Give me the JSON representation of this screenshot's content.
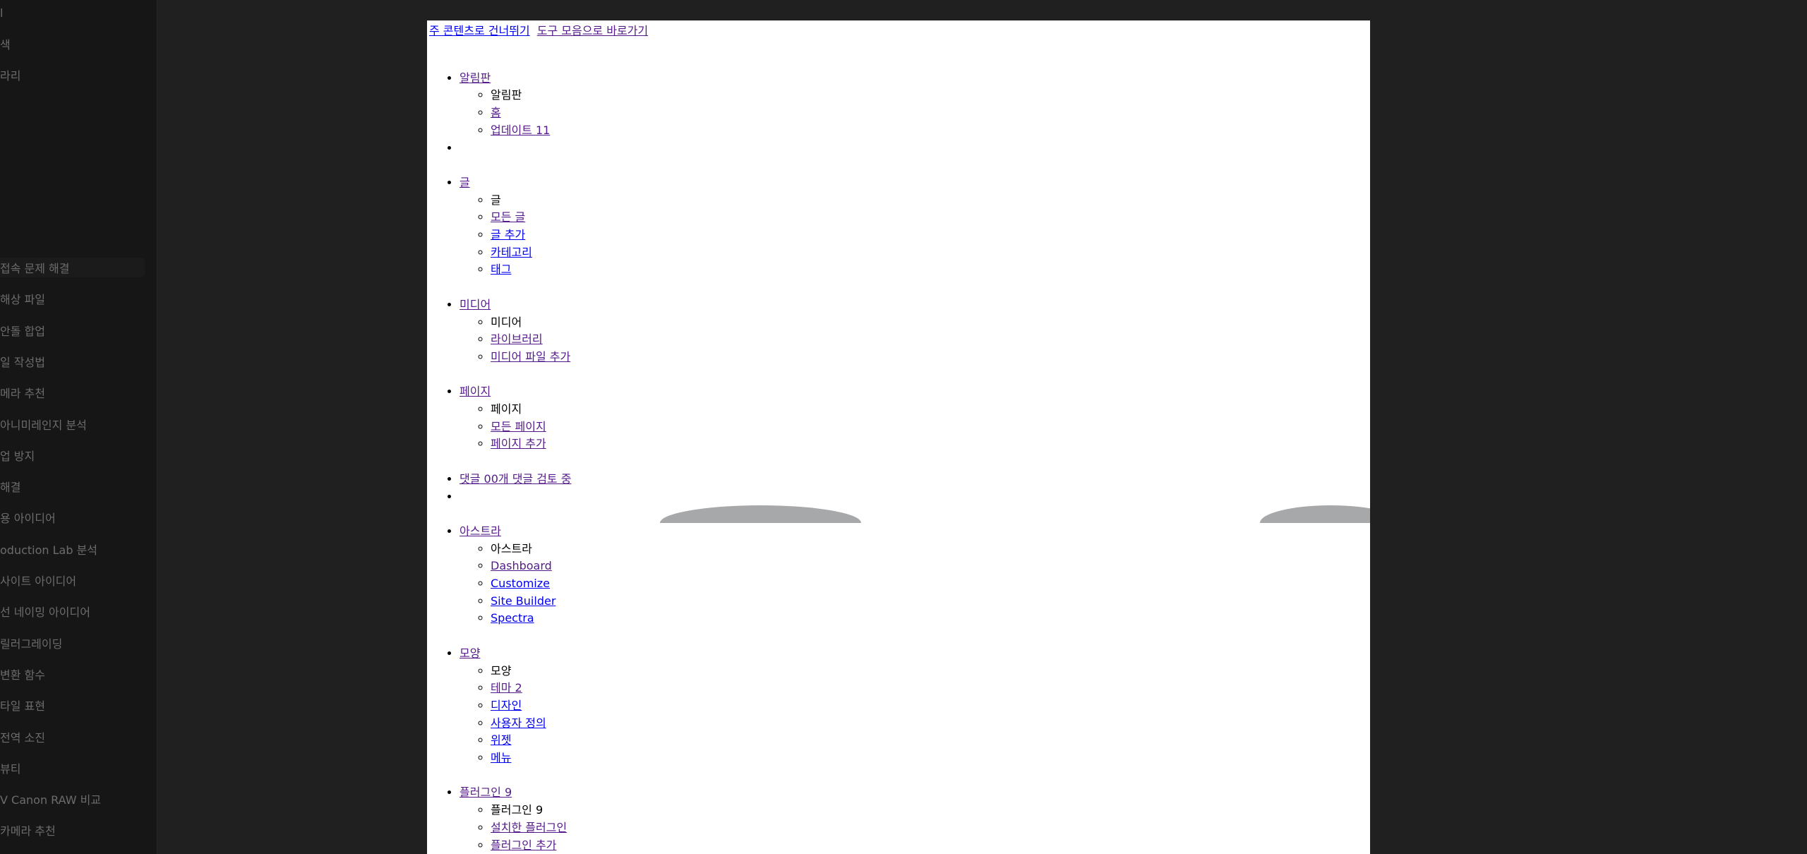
{
  "background": {
    "top_items": [
      "l",
      "색",
      "라리"
    ],
    "chat_items": [
      "접속 문제 해결",
      "해상 파일",
      "안돌 합업",
      "일 작성법",
      "메라 추천",
      "아니미레인지 분석",
      "업 방지",
      "해결",
      "용 아이디어",
      "oduction Lab 분석",
      "사이트 아이디어",
      "선 네이밍 아이디어",
      "릴러그레이딩",
      "변환 함수",
      "타일 표현",
      "전역 소진",
      "뷰티",
      "V Canon RAW 비교",
      "카메라 추천"
    ]
  },
  "skip_links": {
    "main": "주 콘텐츠로 건너뛰기",
    "toolbar": "도구 모음으로 바로가기"
  },
  "menu": {
    "dashboard": {
      "label": "알림판",
      "heading": "알림판",
      "home": "홈",
      "updates": "업데이트 11"
    },
    "posts": {
      "label": "글",
      "heading": "글",
      "all": "모든 글",
      "add": "글 추가",
      "categories": "카테고리",
      "tags": "태그"
    },
    "media": {
      "label": "미디어",
      "heading": "미디어",
      "library": "라이브러리",
      "add": "미디어 파일 추가"
    },
    "pages": {
      "label": "페이지",
      "heading": "페이지",
      "all": "모든 페이지",
      "add": "페이지 추가"
    },
    "comments": {
      "label": "댓글 00개 댓글 검토 중"
    },
    "astra": {
      "label": "아스트라",
      "heading": "아스트라",
      "dashboard": "Dashboard",
      "customize": "Customize",
      "site_builder": "Site Builder",
      "spectra": "Spectra"
    },
    "appearance": {
      "label": "모양",
      "heading": "모양",
      "themes": "테마 2",
      "design": "디자인",
      "customize": "사용자 정의",
      "widgets": "위젯",
      "menus": "메뉴"
    },
    "plugins": {
      "label": "플러그인 9",
      "heading": "플러그인 9",
      "installed": "설치한 플러그인",
      "add": "플러그인 추가"
    }
  }
}
